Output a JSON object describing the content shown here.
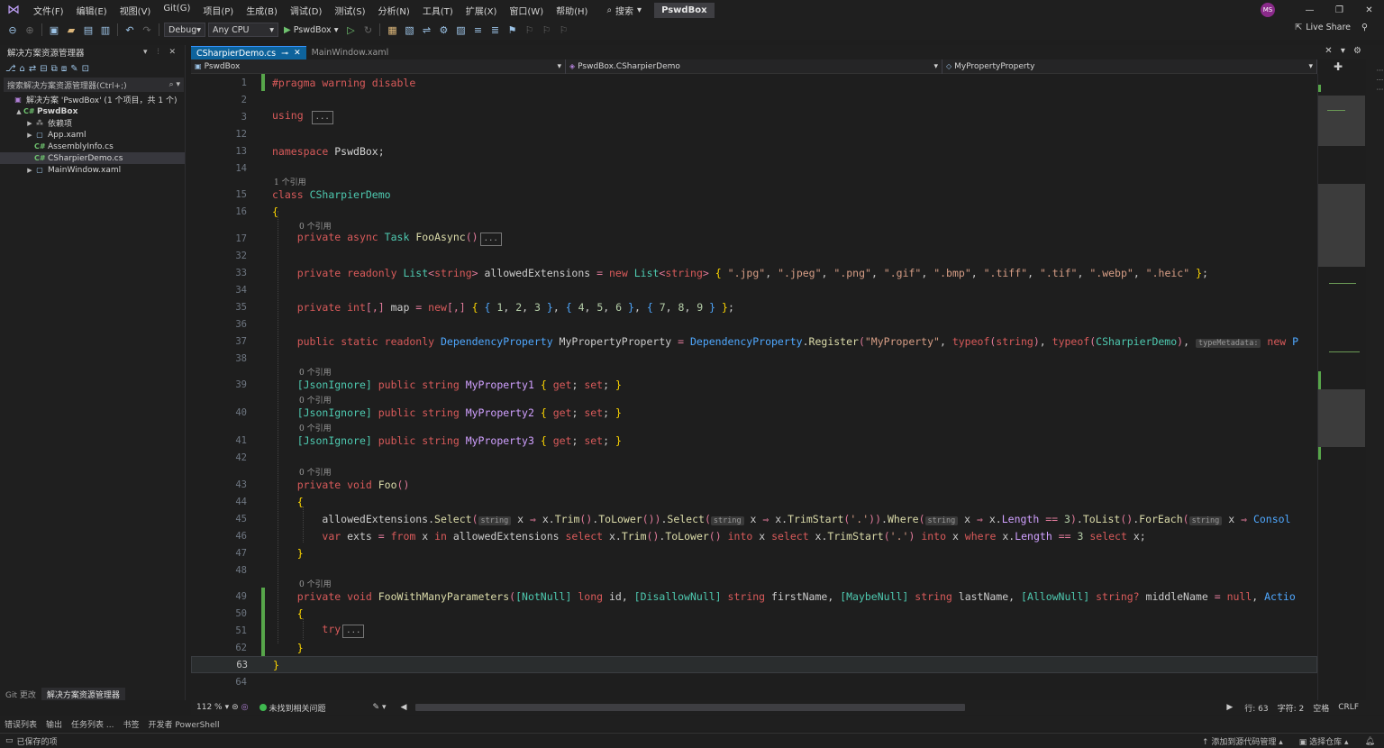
{
  "menubar": {
    "items": [
      "文件(F)",
      "编辑(E)",
      "视图(V)",
      "Git(G)",
      "项目(P)",
      "生成(B)",
      "调试(D)",
      "测试(S)",
      "分析(N)",
      "工具(T)",
      "扩展(X)",
      "窗口(W)",
      "帮助(H)"
    ],
    "search_label": "搜索",
    "solution_name": "PswdBox",
    "user_initials": "MS"
  },
  "toolbar": {
    "config": "Debug",
    "platform": "Any CPU",
    "run_target": "PswdBox",
    "liveshare": "Live Share"
  },
  "solution_explorer": {
    "title": "解决方案资源管理器",
    "search_placeholder": "搜索解决方案资源管理器(Ctrl+;)",
    "tree": [
      {
        "label": "解决方案 'PswdBox' (1 个项目，共 1 个)",
        "icon": "solution-icon",
        "indent": 0,
        "arrow": ""
      },
      {
        "label": "PswdBox",
        "icon": "csproj-icon",
        "indent": 1,
        "arrow": "▲",
        "bold": true
      },
      {
        "label": "依赖项",
        "icon": "dependencies-icon",
        "indent": 2,
        "arrow": "▶"
      },
      {
        "label": "App.xaml",
        "icon": "xaml-icon",
        "indent": 2,
        "arrow": "▶"
      },
      {
        "label": "AssemblyInfo.cs",
        "icon": "csharp-icon",
        "indent": 2,
        "arrow": ""
      },
      {
        "label": "CSharpierDemo.cs",
        "icon": "csharp-icon",
        "indent": 2,
        "arrow": "",
        "selected": true
      },
      {
        "label": "MainWindow.xaml",
        "icon": "xaml-icon",
        "indent": 2,
        "arrow": "▶"
      }
    ],
    "bottom_tabs": [
      "Git 更改",
      "解决方案资源管理器"
    ]
  },
  "editor": {
    "tabs": [
      {
        "label": "CSharpierDemo.cs",
        "active": true
      },
      {
        "label": "MainWindow.xaml",
        "active": false
      }
    ],
    "nav": {
      "project": "PswdBox",
      "type": "PswdBox.CSharpierDemo",
      "member": "MyPropertyProperty"
    },
    "codelens": {
      "one_ref": "1 个引用",
      "zero_ref": "0 个引用"
    },
    "line_numbers": [
      "1",
      "2",
      "3",
      "12",
      "13",
      "14",
      "15",
      "16",
      "17",
      "32",
      "33",
      "34",
      "35",
      "36",
      "37",
      "38",
      "39",
      "40",
      "41",
      "42",
      "43",
      "44",
      "45",
      "46",
      "47",
      "48",
      "49",
      "50",
      "51",
      "62",
      "63",
      "64"
    ],
    "status": {
      "zoom": "112 %",
      "issues": "未找到相关问题",
      "line": "行: 63",
      "char": "字符: 2",
      "spaces": "空格",
      "eol": "CRLF"
    }
  },
  "bottom_tabs": [
    "错误列表",
    "输出",
    "任务列表 ...",
    "书签",
    "开发者 PowerShell"
  ],
  "statusbar": {
    "saved": "已保存的项",
    "add_source": "添加到源代码管理",
    "select_repo": "选择仓库"
  }
}
